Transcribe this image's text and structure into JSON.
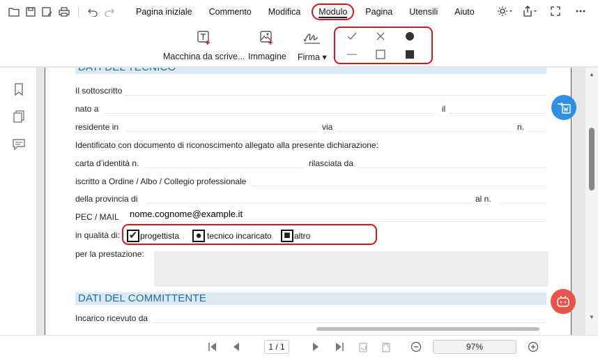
{
  "menu": {
    "items": [
      {
        "label": "Pagina iniziale"
      },
      {
        "label": "Commento"
      },
      {
        "label": "Modifica"
      },
      {
        "label": "Modulo"
      },
      {
        "label": "Pagina"
      },
      {
        "label": "Utensili"
      },
      {
        "label": "Aiuto"
      }
    ],
    "active": "Modulo"
  },
  "ribbon": {
    "typewriter": "Macchina da scrive...",
    "image": "Immagine",
    "signature": "Firma",
    "form_shapes": [
      "check",
      "cross",
      "circle",
      "line",
      "square",
      "filled-square"
    ]
  },
  "document": {
    "section1": "DATI DEL TECNICO",
    "sottoscritto": "Il sottoscritto",
    "nato_a": "nato a",
    "il": "il",
    "residente": "residente  in",
    "via": "via",
    "n": "n.",
    "identificato": "Identificato con documento di riconoscimento allegato alla presente dichiarazione:",
    "carta": "carta d’identità n.",
    "rilasciata": "rilasciata da",
    "iscritto": "iscritto a Ordine / Albo / Collegio professionale",
    "provincia": "della  provincia  di",
    "al_n": "al  n.",
    "pec_label": "PEC / MAIL",
    "pec_value": "nome.cognome@example.it",
    "qualita_label": "in qualità di:",
    "qualita_options": [
      {
        "label": "progettista",
        "mark": "✔"
      },
      {
        "label": "tecnico incaricato",
        "mark": "●"
      },
      {
        "label": "altro",
        "mark": "■"
      }
    ],
    "prestazione": "per la prestazione:",
    "section2": "DATI DEL COMMITTENTE",
    "incarico": "Incarico ricevuto da"
  },
  "bottom": {
    "page": "1 / 1",
    "zoom": "97%"
  },
  "colors": {
    "highlight": "#d9141c",
    "section_bg": "#dbe8f1",
    "section_text": "#1f6e98",
    "fab_word": "#2f8fe0",
    "fab_ai": "#e8534a"
  }
}
